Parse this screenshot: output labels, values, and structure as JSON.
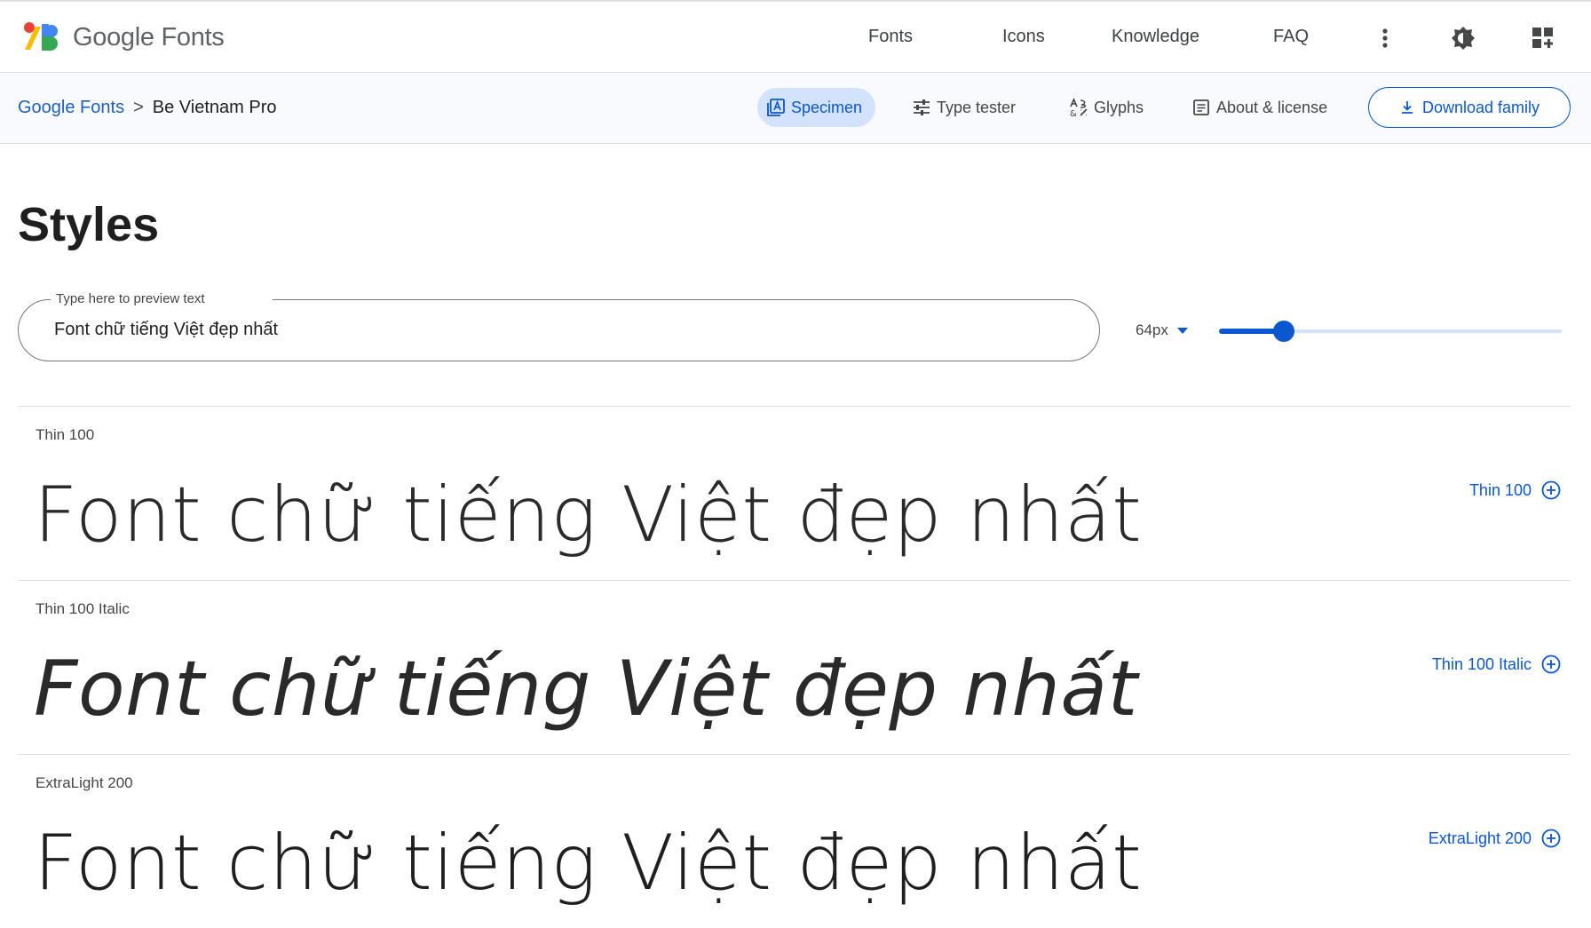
{
  "header": {
    "brand": "Google Fonts",
    "nav": [
      {
        "label": "Fonts"
      },
      {
        "label": "Icons"
      },
      {
        "label": "Knowledge"
      },
      {
        "label": "FAQ"
      }
    ]
  },
  "subheader": {
    "breadcrumb": {
      "root": "Google Fonts",
      "separator": ">",
      "current": "Be Vietnam Pro"
    },
    "tabs": {
      "specimen": "Specimen",
      "type_tester": "Type tester",
      "glyphs": "Glyphs",
      "about": "About & license"
    },
    "download_label": "Download family"
  },
  "main": {
    "title": "Styles",
    "preview": {
      "label": "Type here to preview text",
      "value": "Font chữ tiếng Việt đẹp nhất"
    },
    "size": {
      "label": "64px",
      "slider_fraction": 0.19
    },
    "styles": [
      {
        "name": "Thin 100",
        "sample": "Font chữ tiếng Việt đẹp nhất",
        "action": "Thin 100"
      },
      {
        "name": "Thin 100 Italic",
        "sample": "Font chữ tiếng Việt đẹp nhất",
        "action": "Thin 100 Italic"
      },
      {
        "name": "ExtraLight 200",
        "sample": "Font chữ tiếng Việt đẹp nhất",
        "action": "ExtraLight 200"
      }
    ]
  },
  "colors": {
    "accent": "#0b57d0",
    "active_tab_bg": "#d3e3fd",
    "subheader_bg": "#f8fafd"
  }
}
